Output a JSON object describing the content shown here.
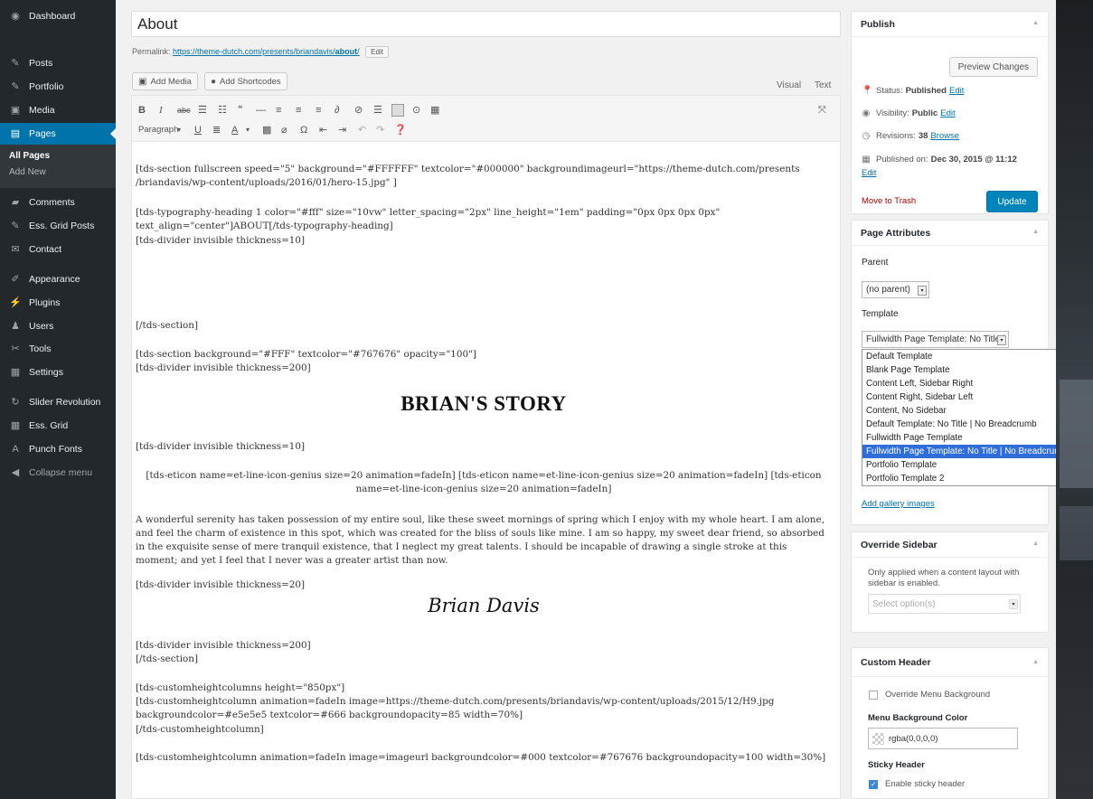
{
  "sidebar": {
    "items": [
      {
        "label": "Dashboard",
        "icon": "dashboard-icon",
        "glyph": "◉"
      },
      {
        "label": "Posts",
        "icon": "pin-icon",
        "glyph": "✎"
      },
      {
        "label": "Portfolio",
        "icon": "pin-icon",
        "glyph": "✎"
      },
      {
        "label": "Media",
        "icon": "media-icon",
        "glyph": "▣"
      },
      {
        "label": "Pages",
        "icon": "page-icon",
        "glyph": "▤"
      },
      {
        "label": "Comments",
        "icon": "comment-icon",
        "glyph": "▰"
      },
      {
        "label": "Ess. Grid Posts",
        "icon": "pin-icon",
        "glyph": "✎"
      },
      {
        "label": "Contact",
        "icon": "mail-icon",
        "glyph": "✉"
      },
      {
        "label": "Appearance",
        "icon": "brush-icon",
        "glyph": "✐"
      },
      {
        "label": "Plugins",
        "icon": "plug-icon",
        "glyph": "⚡"
      },
      {
        "label": "Users",
        "icon": "user-icon",
        "glyph": "♟"
      },
      {
        "label": "Tools",
        "icon": "wrench-icon",
        "glyph": "✂"
      },
      {
        "label": "Settings",
        "icon": "settings-icon",
        "glyph": "▦"
      },
      {
        "label": "Slider Revolution",
        "icon": "refresh-icon",
        "glyph": "↻"
      },
      {
        "label": "Ess. Grid",
        "icon": "grid-icon",
        "glyph": "▦"
      },
      {
        "label": "Punch Fonts",
        "icon": "font-icon",
        "glyph": "A"
      },
      {
        "label": "Collapse menu",
        "icon": "collapse-icon",
        "glyph": "◀"
      }
    ],
    "submenu": {
      "all_pages": "All Pages",
      "add_new": "Add New"
    }
  },
  "editor": {
    "title": "About",
    "permalink_label": "Permalink:",
    "permalink_url": "https://theme-dutch.com/presents/briandavis/",
    "permalink_slug": "about",
    "permalink_tail": "/",
    "edit_btn": "Edit",
    "add_media": "Add Media",
    "add_shortcodes": "Add Shortcodes",
    "tab_visual": "Visual",
    "tab_text": "Text",
    "format_select": "Paragraph",
    "content": {
      "p1": "[tds-section fullscreen speed=\"5\" background=\"#FFFFFF\" textcolor=\"#000000\" backgroundimageurl=\"https://theme-dutch.com/presents /briandavis/wp-content/uploads/2016/01/hero-15.jpg\" ]",
      "p2": "[tds-typography-heading 1 color=\"#fff\" size=\"10vw\" letter_spacing=\"2px\" line_height=\"1em\" padding=\"0px 0px 0px 0px\" text_align=\"center\"]ABOUT[/tds-typography-heading]",
      "p2b": "[tds-divider invisible thickness=10]",
      "p3": "[/tds-section]",
      "p4": "[tds-section background=\"#FFF\" textcolor=\"#767676\" opacity=\"100\"]",
      "p4b": "[tds-divider invisible thickness=200]",
      "heading": "BRIAN'S STORY",
      "p5": "[tds-divider invisible thickness=10]",
      "p6": "[tds-eticon name=et-line-icon-genius size=20 animation=fadeIn] [tds-eticon name=et-line-icon-genius size=20 animation=fadeIn] [tds-eticon name=et-line-icon-genius size=20 animation=fadeIn]",
      "p7": "A wonderful serenity has taken possession of my entire soul, like these sweet mornings of spring which I enjoy with my whole heart. I am alone, and feel the charm of existence in this spot, which was created for the bliss of souls like mine. I am so happy, my sweet dear friend, so absorbed in the exquisite sense of mere tranquil existence, that I neglect my great talents. I should be incapable of drawing a single stroke at this moment; and yet I feel that I never was a greater artist than now.",
      "p7b": "[tds-divider invisible thickness=20]",
      "signature": "Brian Davis",
      "p8": "[tds-divider invisible thickness=200]",
      "p8b": "[/tds-section]",
      "p9": "[tds-customheightcolumns height=\"850px\"]",
      "p9b": "[tds-customheightcolumn animation=fadeIn image=https://theme-dutch.com/presents/briandavis/wp-content/uploads/2015/12/H9.jpg backgroundcolor=#e5e5e5 textcolor=#666 backgroundopacity=85 width=70%]",
      "p9c": "[/tds-customheightcolumn]",
      "p10": "[tds-customheightcolumn animation=fadeIn image=imageurl backgroundcolor=#000 textcolor=#767676 backgroundopacity=100 width=30%]"
    }
  },
  "publish": {
    "title": "Publish",
    "preview": "Preview Changes",
    "status_label": "Status:",
    "status_value": "Published",
    "visibility_label": "Visibility:",
    "visibility_value": "Public",
    "revisions_label": "Revisions:",
    "revisions_value": "38",
    "browse": "Browse",
    "published_on_label": "Published on:",
    "published_on_value": "Dec 30, 2015 @ 11:12",
    "edit": "Edit",
    "trash": "Move to Trash",
    "update": "Update"
  },
  "attributes": {
    "title": "Page Attributes",
    "parent_label": "Parent",
    "parent_value": "(no parent)",
    "template_label": "Template",
    "template_value": "Fullwidth Page Template: No Title | ",
    "options": [
      "Default Template",
      "Blank Page Template",
      "Content Left, Sidebar Right",
      "Content Right, Sidebar Left",
      "Content, No Sidebar",
      "Default Template: No Title | No Breadcrumb",
      "Fullwidth Page Template",
      "Fullwidth Page Template: No Title | No Breadcrumbs",
      "Portfolio Template",
      "Portfolio Template 2"
    ],
    "add_gallery": "Add gallery images"
  },
  "override_sidebar": {
    "title": "Override Sidebar",
    "description": "Only applied when a content layout with sidebar is enabled.",
    "placeholder": "Select option(s)"
  },
  "custom_header": {
    "title": "Custom Header",
    "override_label": "Override Menu Background",
    "bg_color_label": "Menu Background Color",
    "bg_color_value": "rgba(0,0,0,0)",
    "sticky_label": "Sticky Header",
    "sticky_checkbox": "Enable sticky header"
  },
  "colors": {
    "admin_blue": "#0073aa",
    "sidebar_bg": "#23282d",
    "update_btn": "#0085ba",
    "selected_option": "#2f6ed9"
  }
}
